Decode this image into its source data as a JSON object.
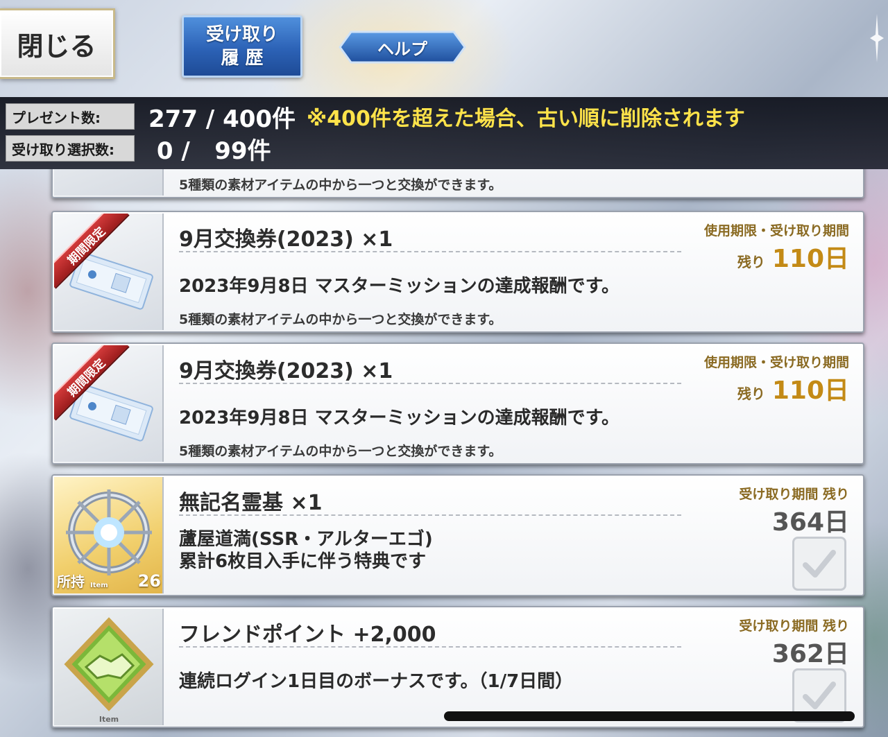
{
  "header": {
    "close_label": "閉じる",
    "history_label_line1": "受け取り",
    "history_label_line2": "履 歴",
    "help_label": "ヘルプ"
  },
  "info": {
    "present_label": "プレゼント数:",
    "present_count": "277 / 400件",
    "present_note": "※400件を超えた場合、古い順に削除されます",
    "selected_label": "受け取り選択数:",
    "selected_count": " 0 /   99件"
  },
  "items": [
    {
      "desc2": "5種類の素材アイテムの中から一つと交換ができます。"
    },
    {
      "badge": "期間限定",
      "title": "9月交換券(2023) ×1",
      "period_label": "使用期限・受け取り期間",
      "remain_label": "残り",
      "remain_days": "110日",
      "desc1": "2023年9月8日 マスターミッションの達成報酬です。",
      "desc2": "5種類の素材アイテムの中から一つと交換ができます。"
    },
    {
      "badge": "期間限定",
      "title": "9月交換券(2023) ×1",
      "period_label": "使用期限・受け取り期間",
      "remain_label": "残り",
      "remain_days": "110日",
      "desc1": "2023年9月8日 マスターミッションの達成報酬です。",
      "desc2": "5種類の素材アイテムの中から一つと交換ができます。"
    },
    {
      "title": "無記名霊基 ×1",
      "period_label": "受け取り期間 残り",
      "remain_days": "364日",
      "desc_line1": "蘆屋道満(SSR・アルターエゴ)",
      "desc_line2": "累計6枚目入手に伴う特典です",
      "owned_label": "所持",
      "item_tag": "Item",
      "owned_count": "26"
    },
    {
      "title": "フレンドポイント +2,000",
      "period_label": "受け取り期間 残り",
      "remain_days": "362日",
      "desc1": "連続ログイン1日目のボーナスです。（1/7日間）",
      "item_tag": "Item"
    }
  ],
  "colors": {
    "accent_gold": "#c38a16",
    "note_yellow": "#ffe34a",
    "history_blue": "#2c62b6"
  }
}
